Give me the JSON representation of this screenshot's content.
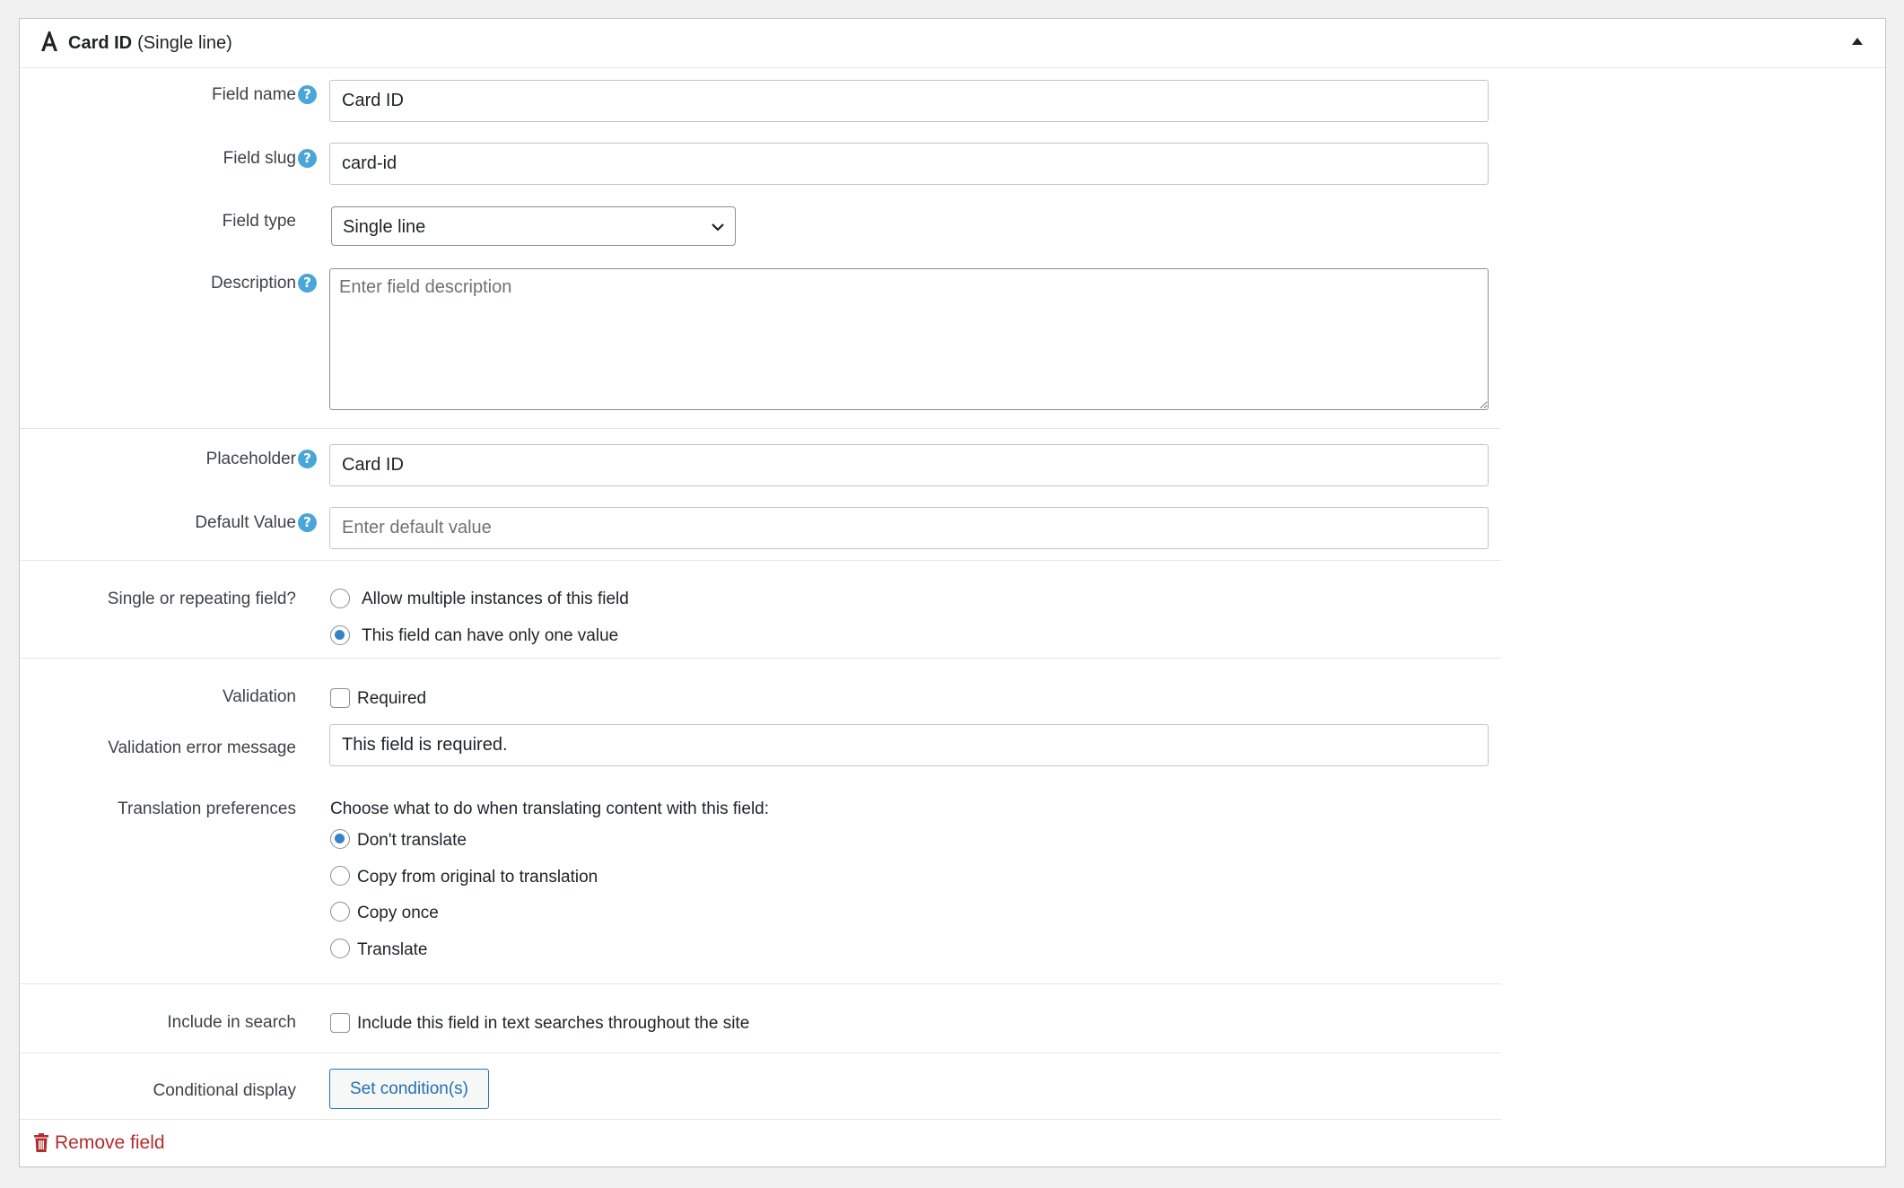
{
  "header": {
    "field_name": "Card ID",
    "field_type": "(Single line)",
    "type_icon": "letter-a-icon",
    "collapse_icon": "triangle-up-icon"
  },
  "fields": {
    "field_name": {
      "label": "Field name",
      "value": "Card ID"
    },
    "field_slug": {
      "label": "Field slug",
      "value": "card-id"
    },
    "field_type": {
      "label": "Field type",
      "selected": "Single line"
    },
    "description": {
      "label": "Description",
      "placeholder": "Enter field description",
      "value": ""
    },
    "placeholder": {
      "label": "Placeholder",
      "value": "Card ID"
    },
    "default_value": {
      "label": "Default Value",
      "placeholder": "Enter default value",
      "value": ""
    },
    "repeating": {
      "label": "Single or repeating field?",
      "options": [
        {
          "label": "Allow multiple instances of this field",
          "checked": false
        },
        {
          "label": "This field can have only one value",
          "checked": true
        }
      ]
    },
    "validation": {
      "label": "Validation",
      "required_label": "Required",
      "required_checked": false
    },
    "validation_error": {
      "label": "Validation error message",
      "value": "This field is required."
    },
    "translation": {
      "label": "Translation preferences",
      "intro": "Choose what to do when translating content with this field:",
      "options": [
        {
          "label": "Don't translate",
          "checked": true
        },
        {
          "label": "Copy from original to translation",
          "checked": false
        },
        {
          "label": "Copy once",
          "checked": false
        },
        {
          "label": "Translate",
          "checked": false
        }
      ]
    },
    "search": {
      "label": "Include in search",
      "option_label": "Include this field in text searches throughout the site",
      "checked": false
    },
    "conditional": {
      "label": "Conditional display",
      "button_label": "Set condition(s)"
    }
  },
  "footer": {
    "remove_label": "Remove field",
    "remove_icon": "trash-icon"
  },
  "help_glyph": "?",
  "colors": {
    "accent": "#2271b1",
    "help": "#4aa6d9",
    "danger": "#b32d2e",
    "radio_checked": "#3582c4"
  }
}
